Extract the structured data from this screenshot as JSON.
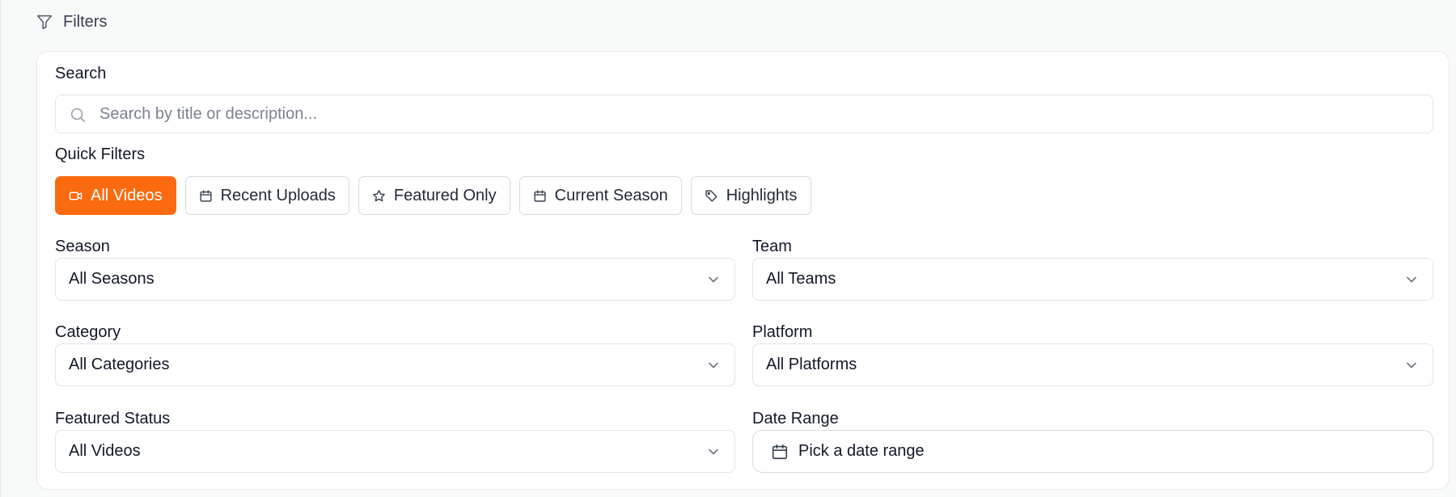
{
  "header": {
    "title": "Filters",
    "icon": "filter-icon"
  },
  "search": {
    "label": "Search",
    "placeholder": "Search by title or description...",
    "value": ""
  },
  "quick_filters": {
    "label": "Quick Filters",
    "items": [
      {
        "label": "All Videos",
        "icon": "video-icon",
        "active": true
      },
      {
        "label": "Recent Uploads",
        "icon": "calendar-icon",
        "active": false
      },
      {
        "label": "Featured Only",
        "icon": "star-icon",
        "active": false
      },
      {
        "label": "Current Season",
        "icon": "calendar-icon",
        "active": false
      },
      {
        "label": "Highlights",
        "icon": "tag-icon",
        "active": false
      }
    ]
  },
  "fields": {
    "season": {
      "label": "Season",
      "value": "All Seasons"
    },
    "team": {
      "label": "Team",
      "value": "All Teams"
    },
    "category": {
      "label": "Category",
      "value": "All Categories"
    },
    "platform": {
      "label": "Platform",
      "value": "All Platforms"
    },
    "featured_status": {
      "label": "Featured Status",
      "value": "All Videos"
    },
    "date_range": {
      "label": "Date Range",
      "placeholder": "Pick a date range"
    }
  },
  "colors": {
    "accent": "#fb6a0f",
    "border": "#e2e4e8",
    "panel_bg": "#f8f9f9"
  }
}
